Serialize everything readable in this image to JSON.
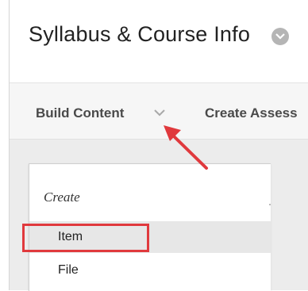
{
  "page": {
    "title": "Syllabus & Course Info"
  },
  "action_bar": {
    "build_content": "Build Content",
    "create_assessment": "Create Assess"
  },
  "menu": {
    "heading": "Create",
    "items": [
      {
        "label": "Item",
        "highlighted": true
      },
      {
        "label": "File",
        "highlighted": false
      }
    ]
  },
  "annotation": {
    "color": "#e0393d",
    "arrow_target": "build-content-chevron",
    "highlight_target": "Item"
  }
}
